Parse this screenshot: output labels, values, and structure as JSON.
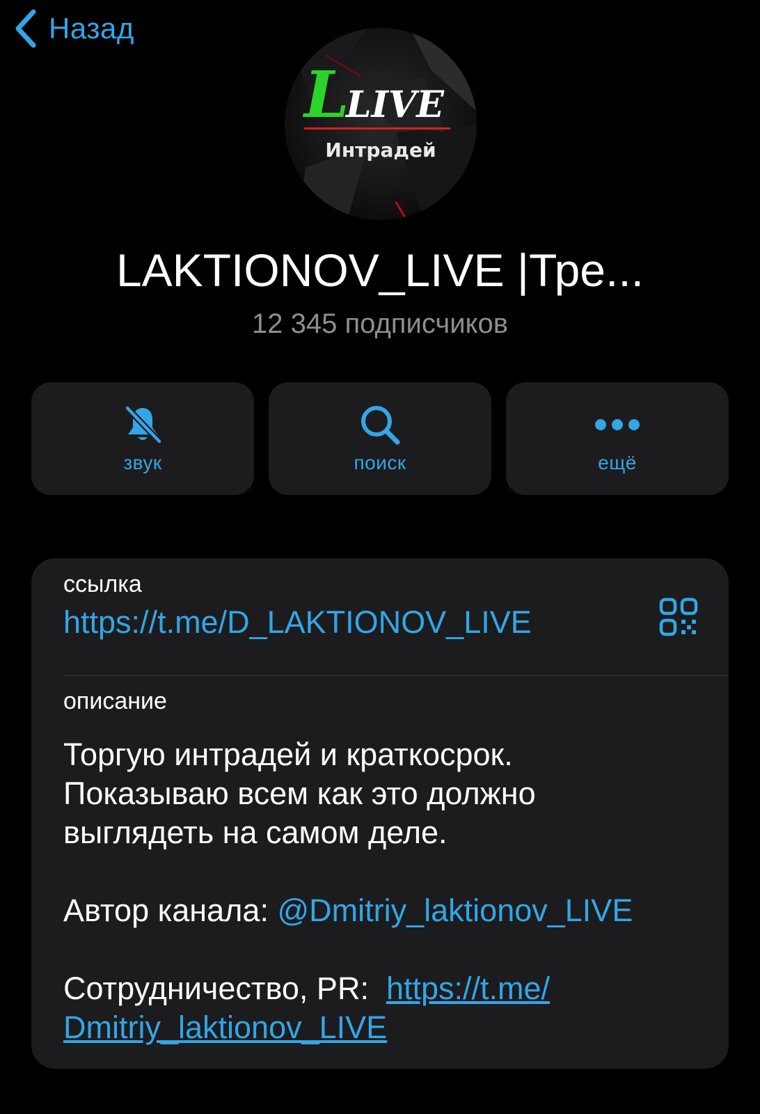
{
  "nav": {
    "back_label": "Назад"
  },
  "avatar": {
    "logo_text_big": "L",
    "logo_text_small": "LIVE",
    "logo_caption": "Интрадей"
  },
  "channel": {
    "title": "LAKTIONOV_LIVE |Тре...",
    "subscribers": "12 345 подписчиков"
  },
  "actions": [
    {
      "label": "звук",
      "icon": "bell-slash-icon"
    },
    {
      "label": "поиск",
      "icon": "search-icon"
    },
    {
      "label": "ещё",
      "icon": "more-dots-icon"
    }
  ],
  "info": {
    "link_label": "ссылка",
    "link_value": "https://t.me/D_LAKTIONOV_LIVE",
    "qr_icon": "qr-code-icon",
    "description_label": "описание",
    "description_lines": [
      "Торгую интрадей и краткосрок.",
      "Показываю всем как это должно",
      "выглядеть на самом деле."
    ],
    "author_prefix": "Автор канала: ",
    "author_mention": "@Dmitriy_laktionov_LIVE",
    "pr_prefix": "Сотрудничество, PR:  ",
    "pr_link_part1": "https://t.me/",
    "pr_link_part2": "Dmitriy_laktionov_LIVE"
  },
  "colors": {
    "accent": "#32a6e6",
    "background": "#000000",
    "card": "#1c1c1e",
    "secondary_text": "#8d8d93",
    "logo_green": "#2bd32b",
    "logo_red": "#e01b1b"
  }
}
